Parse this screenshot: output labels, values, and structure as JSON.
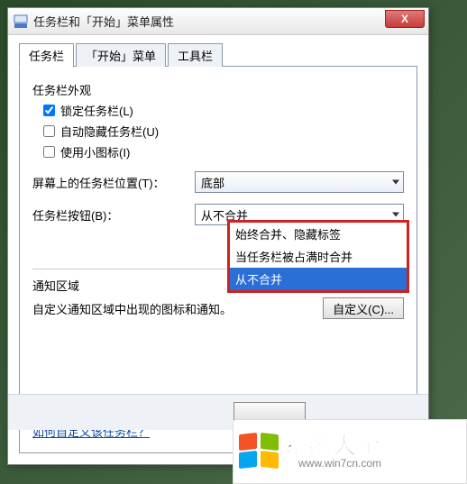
{
  "window": {
    "title": "任务栏和「开始」菜单属性",
    "close_glyph": "X"
  },
  "tabs": {
    "t0": "任务栏",
    "t1": "「开始」菜单",
    "t2": "工具栏"
  },
  "appearance": {
    "group": "任务栏外观",
    "lock": "锁定任务栏(L)",
    "autohide": "自动隐藏任务栏(U)",
    "smallicons": "使用小图标(I)",
    "lock_checked": true,
    "autohide_checked": false,
    "smallicons_checked": false
  },
  "position": {
    "label": "屏幕上的任务栏位置(T)：",
    "value": "底部"
  },
  "buttons": {
    "label": "任务栏按钮(B)：",
    "value": "从不合并",
    "options": {
      "o0": "始终合并、隐藏标签",
      "o1": "当任务栏被占满时合并",
      "o2": "从不合并"
    }
  },
  "notify": {
    "group": "通知区域",
    "desc": "自定义通知区域中出现的图标和通知。",
    "btn": "自定义(C)..."
  },
  "help_link": "如何自定义该任务栏？",
  "watermark": {
    "text": "系统大全",
    "url": "www.win7cn.com"
  }
}
